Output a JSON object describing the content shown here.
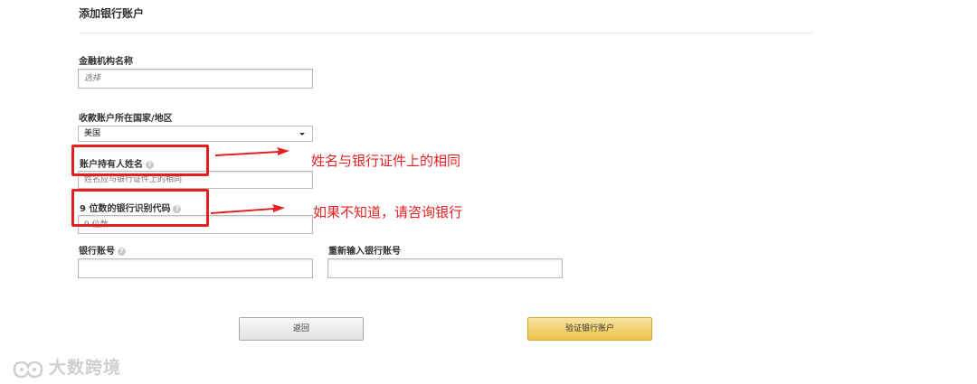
{
  "form": {
    "title": "添加银行账户",
    "institution": {
      "label": "金融机构名称",
      "placeholder": "选择"
    },
    "country": {
      "label": "收款账户所在国家/地区",
      "value": "美国"
    },
    "holder_name": {
      "label": "账户持有人姓名",
      "placeholder": "姓名应与银行证件上的相同"
    },
    "routing": {
      "label": "9 位数的银行识别代码",
      "placeholder": "9 位数"
    },
    "account_number": {
      "label": "银行账号",
      "value": ""
    },
    "account_number_confirm": {
      "label": "重新输入银行账号",
      "value": ""
    },
    "help_icon_glyph": "?"
  },
  "buttons": {
    "back": "返回",
    "verify": "验证银行账户"
  },
  "annotations": {
    "name_note": "姓名与银行证件上的相同",
    "routing_note": "如果不知道，请咨询银行",
    "color": "#e41f1f"
  },
  "watermark": {
    "text": "大数跨境",
    "icon": "brand-logo-icon"
  }
}
